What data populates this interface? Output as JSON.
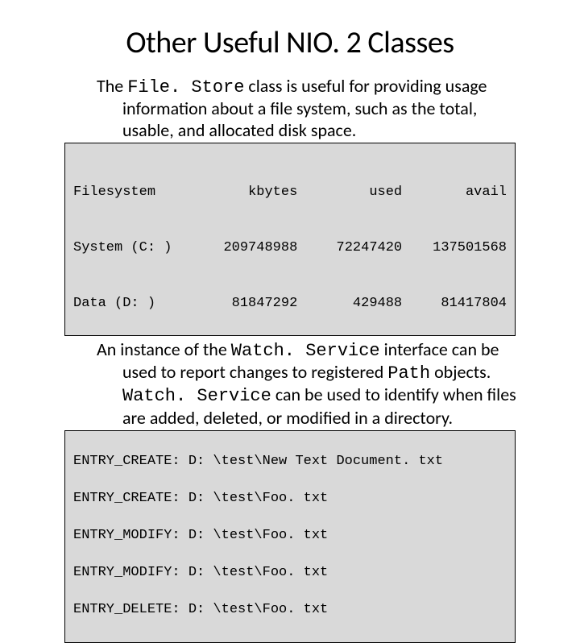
{
  "title": "Other Useful NIO. 2 Classes",
  "para1_a": "The ",
  "para1_code1": "File. Store",
  "para1_b": " class is useful for providing usage information about a file system, such as the total, usable, and allocated disk space.",
  "fs_header": {
    "name": "Filesystem",
    "kbytes": "kbytes",
    "used": "used",
    "avail": "avail"
  },
  "fs_rows": [
    {
      "name": "System (C: )",
      "kbytes": "209748988",
      "used": "72247420",
      "avail": "137501568"
    },
    {
      "name": "Data (D: )",
      "kbytes": "81847292",
      "used": "429488",
      "avail": "81417804"
    }
  ],
  "para2_a": "An instance of the ",
  "para2_code1": "Watch. Service",
  "para2_b": " interface can be used to report changes to registered ",
  "para2_code2": "Path",
  "para2_c": " objects. ",
  "para2_code3": "Watch. Service",
  "para2_d": " can be used to identify when files are added, deleted, or modified in a directory.",
  "events": [
    "ENTRY_CREATE: D: \\test\\New Text Document. txt",
    "ENTRY_CREATE: D: \\test\\Foo. txt",
    "ENTRY_MODIFY: D: \\test\\Foo. txt",
    "ENTRY_MODIFY: D: \\test\\Foo. txt",
    "ENTRY_DELETE: D: \\test\\Foo. txt"
  ]
}
